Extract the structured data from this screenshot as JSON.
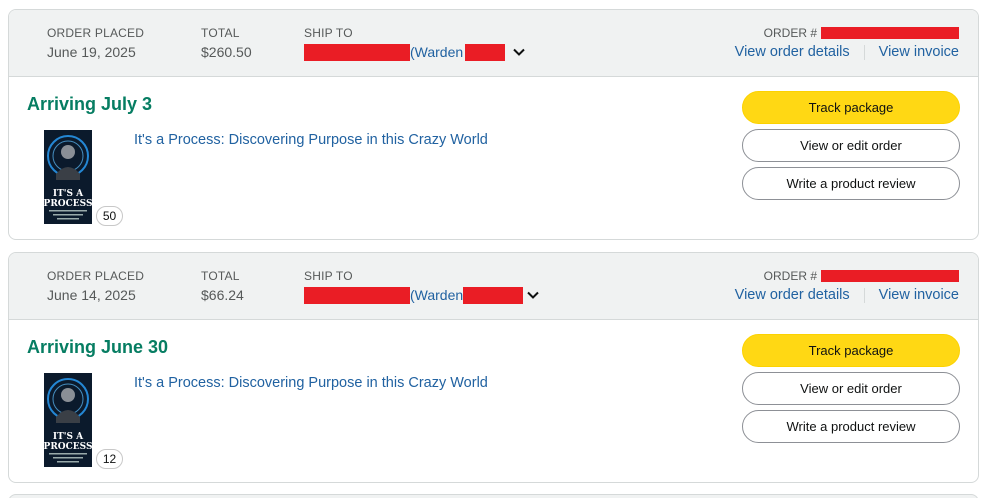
{
  "orders": [
    {
      "placed_label": "ORDER PLACED",
      "placed_value": "June 19, 2025",
      "total_label": "TOTAL",
      "total_value": "$260.50",
      "ship_label": "SHIP TO",
      "ship_name_visible": "(Warden",
      "order_label": "ORDER #",
      "view_details": "View order details",
      "view_invoice": "View invoice",
      "arriving": "Arriving July 3",
      "product_title": "It's a Process: Discovering Purpose in this Crazy World",
      "quantity": "50",
      "track_label": "Track package",
      "view_edit_label": "View or edit order",
      "review_label": "Write a product review"
    },
    {
      "placed_label": "ORDER PLACED",
      "placed_value": "June 14, 2025",
      "total_label": "TOTAL",
      "total_value": "$66.24",
      "ship_label": "SHIP TO",
      "ship_name_visible": "(Warden",
      "order_label": "ORDER #",
      "view_details": "View order details",
      "view_invoice": "View invoice",
      "arriving": "Arriving June 30",
      "product_title": "It's a Process: Discovering Purpose in this Crazy World",
      "quantity": "12",
      "track_label": "Track package",
      "view_edit_label": "View or edit order",
      "review_label": "Write a product review"
    }
  ],
  "book_cover": {
    "title_line1": "IT'S A",
    "title_line2": "PROCESS",
    "bg_color": "#0b1a2c",
    "glow_color": "#2aa3ff"
  },
  "colors": {
    "arriving_green": "#067d62",
    "link_blue": "#2162a1",
    "track_yellow": "#ffd814",
    "redaction_red": "#ea1d25"
  }
}
